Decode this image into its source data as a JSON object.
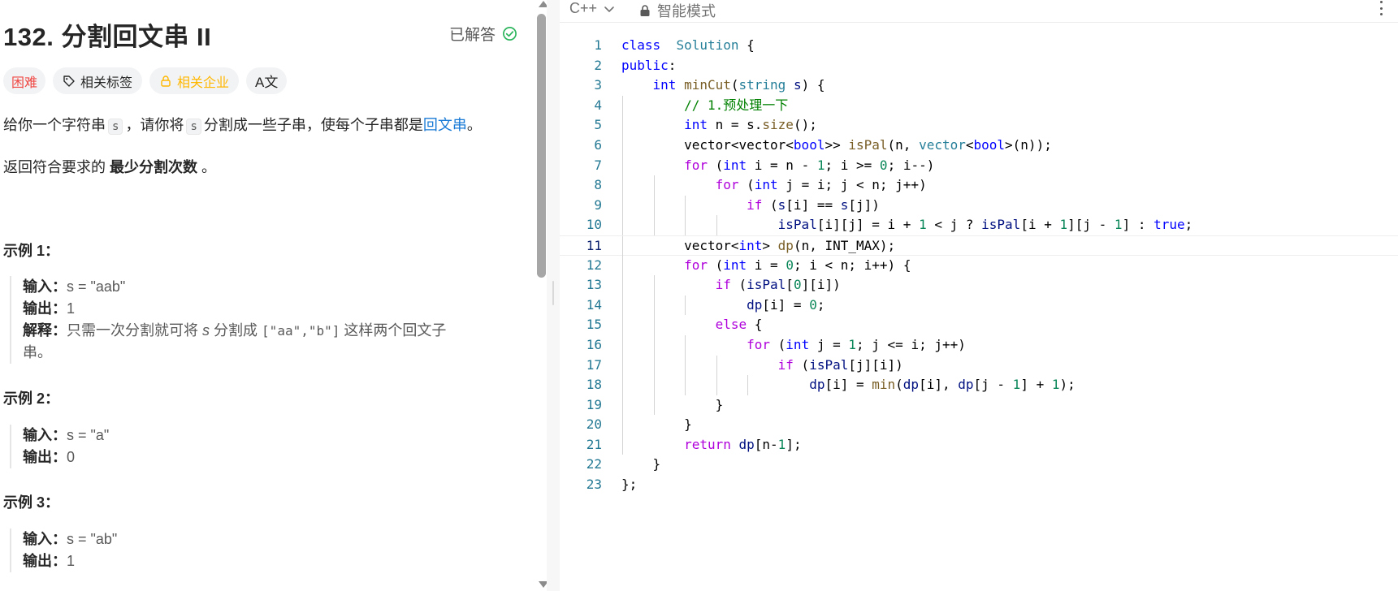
{
  "problem": {
    "title": "132. 分割回文串 II",
    "status": "已解答",
    "tags": {
      "difficulty": "困难",
      "related_tags": "相关标签",
      "related_companies": "相关企业",
      "translate": "A文"
    },
    "description": {
      "p1_a": "给你一个字符串",
      "p1_code1": "s",
      "p1_b": "，请你将",
      "p1_code2": "s",
      "p1_c": "分割成一些子串，使每个子串都是",
      "p1_link": "回文串",
      "p1_d": "。",
      "p2_a": "返回符合要求的",
      "p2_bold": "最少分割次数",
      "p2_b": "。"
    },
    "examples": [
      {
        "title": "示例 1：",
        "input_label": "输入：",
        "input": "s = \"aab\"",
        "output_label": "输出：",
        "output": "1",
        "explain_label": "解释：",
        "explain_a": "只需一次分割就可将",
        "explain_var": "s",
        "explain_b": "分割成",
        "explain_code": "[\"aa\",\"b\"]",
        "explain_c": "这样两个回文子",
        "explain_d": "串。"
      },
      {
        "title": "示例 2：",
        "input_label": "输入：",
        "input": "s = \"a\"",
        "output_label": "输出：",
        "output": "0"
      },
      {
        "title": "示例 3：",
        "input_label": "输入：",
        "input": "s = \"ab\"",
        "output_label": "输出：",
        "output": "1"
      }
    ]
  },
  "editor": {
    "language": "C++",
    "mode": "智能模式",
    "active_line": 11,
    "lines": [
      {
        "n": "1"
      },
      {
        "n": "2"
      },
      {
        "n": "3"
      },
      {
        "n": "4"
      },
      {
        "n": "5"
      },
      {
        "n": "6"
      },
      {
        "n": "7"
      },
      {
        "n": "8"
      },
      {
        "n": "9"
      },
      {
        "n": "10"
      },
      {
        "n": "11"
      },
      {
        "n": "12"
      },
      {
        "n": "13"
      },
      {
        "n": "14"
      },
      {
        "n": "15"
      },
      {
        "n": "16"
      },
      {
        "n": "17"
      },
      {
        "n": "18"
      },
      {
        "n": "19"
      },
      {
        "n": "20"
      },
      {
        "n": "21"
      },
      {
        "n": "22"
      },
      {
        "n": "23"
      }
    ],
    "tokens": [
      [
        [
          "kw",
          "class"
        ],
        [
          "",
          "  "
        ],
        [
          "ty",
          "Solution"
        ],
        [
          "",
          " {"
        ]
      ],
      [
        [
          "kw",
          "public"
        ],
        [
          "",
          ":"
        ]
      ],
      [
        [
          "",
          "    "
        ],
        [
          "kw",
          "int"
        ],
        [
          "",
          " "
        ],
        [
          "fn",
          "minCut"
        ],
        [
          "",
          "("
        ],
        [
          "ty",
          "string"
        ],
        [
          "",
          " "
        ],
        [
          "vr",
          "s"
        ],
        [
          "",
          ") {"
        ]
      ],
      [
        [
          "",
          "        "
        ],
        [
          "cm",
          "// 1.预处理一下"
        ]
      ],
      [
        [
          "",
          "        "
        ],
        [
          "kw",
          "int"
        ],
        [
          "",
          " n = s."
        ],
        [
          "fn",
          "size"
        ],
        [
          "",
          "();"
        ]
      ],
      [
        [
          "",
          "        vector<vector<"
        ],
        [
          "kw",
          "bool"
        ],
        [
          "",
          ">> "
        ],
        [
          "fn",
          "isPal"
        ],
        [
          "",
          "(n, "
        ],
        [
          "ty",
          "vector"
        ],
        [
          "",
          "<"
        ],
        [
          "kw",
          "bool"
        ],
        [
          "",
          ">(n));"
        ]
      ],
      [
        [
          "",
          "        "
        ],
        [
          "kw2",
          "for"
        ],
        [
          "",
          " ("
        ],
        [
          "kw",
          "int"
        ],
        [
          "",
          " i = n - "
        ],
        [
          "nm",
          "1"
        ],
        [
          "",
          "; i >= "
        ],
        [
          "nm",
          "0"
        ],
        [
          "",
          "; i--)"
        ]
      ],
      [
        [
          "",
          "            "
        ],
        [
          "kw2",
          "for"
        ],
        [
          "",
          " ("
        ],
        [
          "kw",
          "int"
        ],
        [
          "",
          " j = i; j < n; j++)"
        ]
      ],
      [
        [
          "",
          "                "
        ],
        [
          "kw2",
          "if"
        ],
        [
          "",
          " ("
        ],
        [
          "vr",
          "s"
        ],
        [
          "",
          "[i] == "
        ],
        [
          "vr",
          "s"
        ],
        [
          "",
          "[j])"
        ]
      ],
      [
        [
          "",
          "                    "
        ],
        [
          "vr",
          "isPal"
        ],
        [
          "",
          "[i][j] = i + "
        ],
        [
          "nm",
          "1"
        ],
        [
          "",
          " < j ? "
        ],
        [
          "vr",
          "isPal"
        ],
        [
          "",
          "[i + "
        ],
        [
          "nm",
          "1"
        ],
        [
          "",
          "][j - "
        ],
        [
          "nm",
          "1"
        ],
        [
          "",
          "] : "
        ],
        [
          "kw",
          "true"
        ],
        [
          "",
          ";"
        ]
      ],
      [
        [
          "",
          "        vector<"
        ],
        [
          "kw",
          "int"
        ],
        [
          "",
          "> "
        ],
        [
          "fn",
          "dp"
        ],
        [
          "",
          "(n, INT_MAX);"
        ]
      ],
      [
        [
          "",
          "        "
        ],
        [
          "kw2",
          "for"
        ],
        [
          "",
          " ("
        ],
        [
          "kw",
          "int"
        ],
        [
          "",
          " i = "
        ],
        [
          "nm",
          "0"
        ],
        [
          "",
          "; i < n; i++) {"
        ]
      ],
      [
        [
          "",
          "            "
        ],
        [
          "kw2",
          "if"
        ],
        [
          "",
          " ("
        ],
        [
          "vr",
          "isPal"
        ],
        [
          "",
          "["
        ],
        [
          "nm",
          "0"
        ],
        [
          "",
          "][i])"
        ]
      ],
      [
        [
          "",
          "                "
        ],
        [
          "vr",
          "dp"
        ],
        [
          "",
          "[i] = "
        ],
        [
          "nm",
          "0"
        ],
        [
          "",
          ";"
        ]
      ],
      [
        [
          "",
          "            "
        ],
        [
          "kw2",
          "else"
        ],
        [
          "",
          " {"
        ]
      ],
      [
        [
          "",
          "                "
        ],
        [
          "kw2",
          "for"
        ],
        [
          "",
          " ("
        ],
        [
          "kw",
          "int"
        ],
        [
          "",
          " j = "
        ],
        [
          "nm",
          "1"
        ],
        [
          "",
          "; j <= i; j++)"
        ]
      ],
      [
        [
          "",
          "                    "
        ],
        [
          "kw2",
          "if"
        ],
        [
          "",
          " ("
        ],
        [
          "vr",
          "isPal"
        ],
        [
          "",
          "[j][i])"
        ]
      ],
      [
        [
          "",
          "                        "
        ],
        [
          "vr",
          "dp"
        ],
        [
          "",
          "[i] = "
        ],
        [
          "fn",
          "min"
        ],
        [
          "",
          "("
        ],
        [
          "vr",
          "dp"
        ],
        [
          "",
          "[i], "
        ],
        [
          "vr",
          "dp"
        ],
        [
          "",
          "[j - "
        ],
        [
          "nm",
          "1"
        ],
        [
          "",
          "] + "
        ],
        [
          "nm",
          "1"
        ],
        [
          "",
          ");"
        ]
      ],
      [
        [
          "",
          "            }"
        ]
      ],
      [
        [
          "",
          "        }"
        ]
      ],
      [
        [
          "",
          "        "
        ],
        [
          "kw2",
          "return"
        ],
        [
          "",
          " "
        ],
        [
          "vr",
          "dp"
        ],
        [
          "",
          "[n-"
        ],
        [
          "nm",
          "1"
        ],
        [
          "",
          "];"
        ]
      ],
      [
        [
          "",
          "    }"
        ]
      ],
      [
        [
          "",
          "};"
        ]
      ]
    ],
    "guides": [
      [],
      [],
      [],
      [
        1
      ],
      [
        1
      ],
      [
        1
      ],
      [
        1
      ],
      [
        1,
        2
      ],
      [
        1,
        2,
        3
      ],
      [
        1,
        2,
        3,
        4
      ],
      [
        1
      ],
      [
        1
      ],
      [
        1,
        2
      ],
      [
        1,
        2,
        3
      ],
      [
        1,
        2
      ],
      [
        1,
        2,
        3
      ],
      [
        1,
        2,
        3,
        4
      ],
      [
        1,
        2,
        3,
        4,
        5
      ],
      [
        1,
        2
      ],
      [
        1
      ],
      [
        1
      ],
      [],
      []
    ]
  },
  "colors": {
    "accent_link": "#1a7bd6",
    "hard": "#ef4743",
    "company": "#ffb700",
    "solved_check": "#2db55d"
  }
}
